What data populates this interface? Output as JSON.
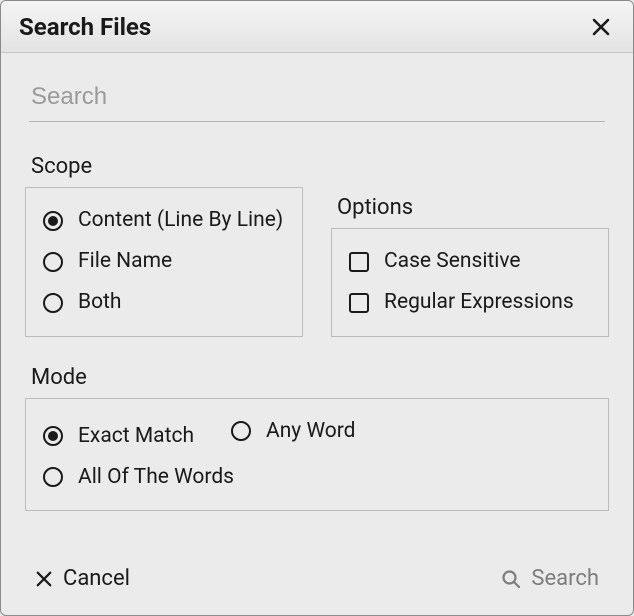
{
  "dialog": {
    "title": "Search Files"
  },
  "search": {
    "placeholder": "Search",
    "value": ""
  },
  "scope": {
    "title": "Scope",
    "selected": "content",
    "options": {
      "content": "Content (Line By Line)",
      "filename": "File Name",
      "both": "Both"
    }
  },
  "options": {
    "title": "Options",
    "case_sensitive": {
      "label": "Case Sensitive",
      "checked": false
    },
    "regex": {
      "label": "Regular Expressions",
      "checked": false
    }
  },
  "mode": {
    "title": "Mode",
    "selected": "exact",
    "options": {
      "exact": "Exact Match",
      "any": "Any Word",
      "all": "All Of The Words"
    }
  },
  "buttons": {
    "cancel": "Cancel",
    "search": "Search"
  }
}
